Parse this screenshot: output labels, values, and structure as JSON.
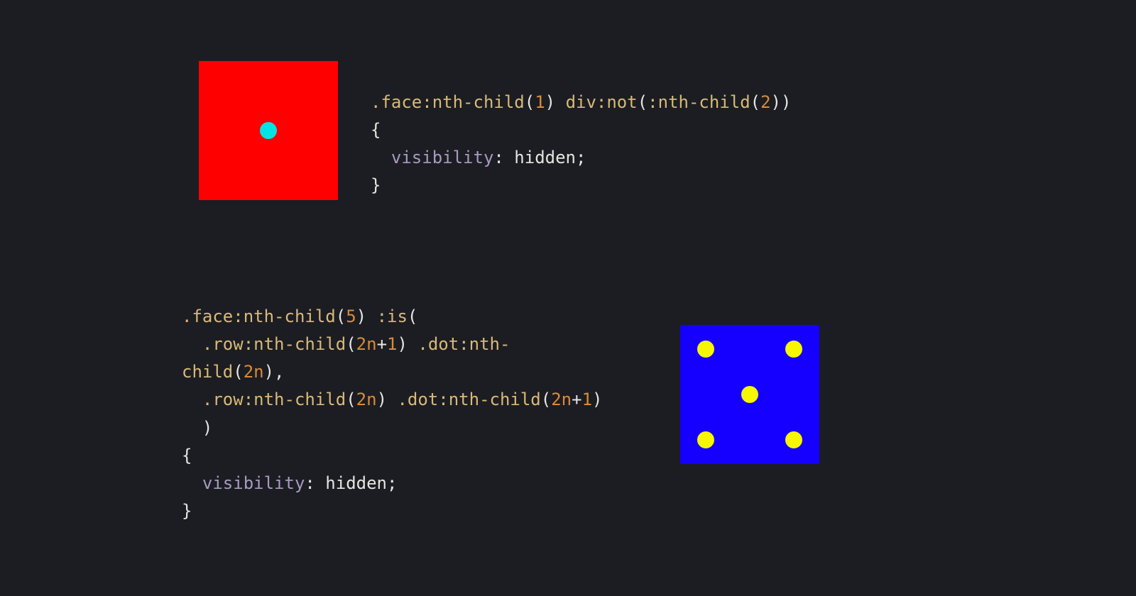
{
  "code1": {
    "l1a": ".face:nth-child",
    "l1b": "(",
    "l1c": "1",
    "l1d": ") ",
    "l1e": "div:not",
    "l1f": "(",
    "l1g": ":nth-child",
    "l1h": "(",
    "l1i": "2",
    "l1j": "))",
    "l2": "{",
    "l3a": "  ",
    "l3b": "visibility",
    "l3c": ": hidden;",
    "l4": "}"
  },
  "code2": {
    "l1a": ".face:nth-child",
    "l1b": "(",
    "l1c": "5",
    "l1d": ") ",
    "l1e": ":is",
    "l1f": "(",
    "l2a": "  ",
    "l2b": ".row:nth-child",
    "l2c": "(",
    "l2d": "2n",
    "l2e": "+",
    "l2f": "1",
    "l2g": ") ",
    "l2h": ".dot:nth-",
    "l3a": "child",
    "l3b": "(",
    "l3c": "2n",
    "l3d": "),",
    "l4a": "  ",
    "l4b": ".row:nth-child",
    "l4c": "(",
    "l4d": "2n",
    "l4e": ") ",
    "l4f": ".dot:nth-child",
    "l4g": "(",
    "l4h": "2n",
    "l4i": "+",
    "l4j": "1",
    "l4k": ")",
    "l5": "  )",
    "l6": "{",
    "l7a": "  ",
    "l7b": "visibility",
    "l7c": ": hidden;",
    "l8": "}"
  }
}
